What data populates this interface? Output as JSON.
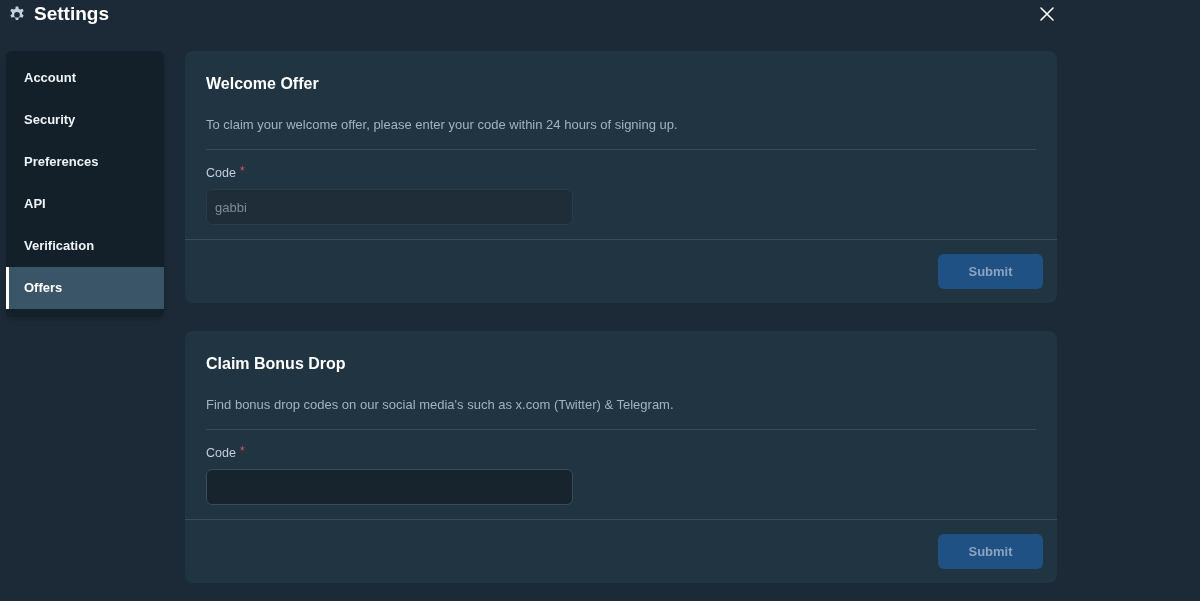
{
  "window": {
    "title": "Settings"
  },
  "sidebar": {
    "items": [
      {
        "label": "Account",
        "selected": false
      },
      {
        "label": "Security",
        "selected": false
      },
      {
        "label": "Preferences",
        "selected": false
      },
      {
        "label": "API",
        "selected": false
      },
      {
        "label": "Verification",
        "selected": false
      },
      {
        "label": "Offers",
        "selected": true
      }
    ]
  },
  "cards": [
    {
      "title": "Welcome Offer",
      "description": "To claim your welcome offer, please enter your code within 24 hours of signing up.",
      "field": {
        "label": "Code",
        "required_mark": "*",
        "value": "gabbi",
        "disabled": true
      },
      "button": {
        "label": "Submit",
        "disabled": true
      }
    },
    {
      "title": "Claim Bonus Drop",
      "description": "Find bonus drop codes on our social media's such as x.com (Twitter) & Telegram.",
      "field": {
        "label": "Code",
        "required_mark": "*",
        "disabled": false
      },
      "button": {
        "label": "Submit",
        "disabled": true
      }
    }
  ]
}
